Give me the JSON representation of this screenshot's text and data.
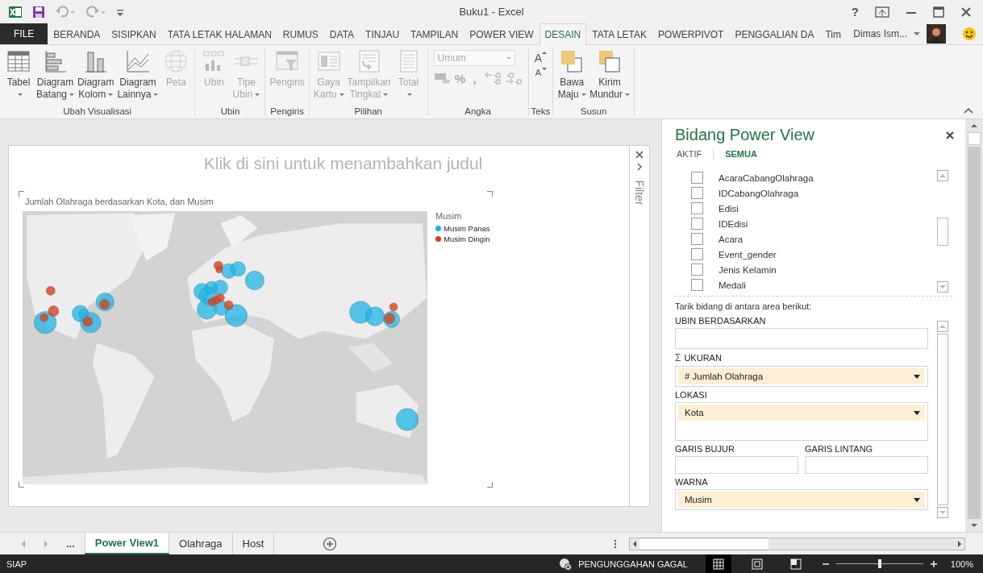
{
  "window": {
    "title": "Buku1 - Excel",
    "help": "?"
  },
  "ribbon_tabs": [
    {
      "label": "FILE",
      "kind": "file",
      "selected": false
    },
    {
      "label": "BERANDA",
      "kind": "tab",
      "selected": false
    },
    {
      "label": "SISIPKAN",
      "kind": "tab",
      "selected": false
    },
    {
      "label": "TATA LETAK HALAMAN",
      "kind": "tab",
      "selected": false
    },
    {
      "label": "RUMUS",
      "kind": "tab",
      "selected": false
    },
    {
      "label": "DATA",
      "kind": "tab",
      "selected": false
    },
    {
      "label": "TINJAU",
      "kind": "tab",
      "selected": false
    },
    {
      "label": "TAMPILAN",
      "kind": "tab",
      "selected": false
    },
    {
      "label": "POWER VIEW",
      "kind": "tab",
      "selected": false
    },
    {
      "label": "DESAIN",
      "kind": "tab",
      "selected": true
    },
    {
      "label": "TATA LETAK",
      "kind": "tab",
      "selected": false
    },
    {
      "label": "POWERPIVOT",
      "kind": "tab",
      "selected": false
    },
    {
      "label": "PENGGALIAN DA",
      "kind": "tab",
      "selected": false
    },
    {
      "label": "Tim",
      "kind": "tab",
      "selected": false
    }
  ],
  "account": {
    "name": "Dimas Ism..."
  },
  "ribbon_groups": [
    {
      "label": "Ubah Visualisasi",
      "kind": "commands",
      "commands": [
        {
          "lines": [
            "Tabel"
          ],
          "dropdown": true,
          "disabled": false
        },
        {
          "lines": [
            "Diagram",
            "Batang"
          ],
          "dropdown": true,
          "disabled": false
        },
        {
          "lines": [
            "Diagram",
            "Kolom"
          ],
          "dropdown": true,
          "disabled": false
        },
        {
          "lines": [
            "Diagram",
            "Lainnya"
          ],
          "dropdown": true,
          "disabled": false
        },
        {
          "lines": [
            "Peta"
          ],
          "dropdown": false,
          "disabled": true
        }
      ]
    },
    {
      "label": "Ubin",
      "kind": "commands",
      "commands": [
        {
          "lines": [
            "Ubin"
          ],
          "dropdown": false,
          "disabled": true
        },
        {
          "lines": [
            "Tipe",
            "Ubin"
          ],
          "dropdown": true,
          "disabled": true
        }
      ]
    },
    {
      "label": "Pengiris",
      "kind": "commands",
      "commands": [
        {
          "lines": [
            "Pengiris"
          ],
          "dropdown": false,
          "disabled": true
        }
      ]
    },
    {
      "label": "Pilihan",
      "kind": "commands",
      "commands": [
        {
          "lines": [
            "Gaya",
            "Kartu"
          ],
          "dropdown": true,
          "disabled": true
        },
        {
          "lines": [
            "Tampilkan",
            "Tingkat"
          ],
          "dropdown": true,
          "disabled": true
        },
        {
          "lines": [
            "Total"
          ],
          "dropdown": true,
          "disabled": true
        }
      ]
    },
    {
      "label": "Angka",
      "kind": "number",
      "format": "Umum",
      "symbols": [
        "%",
        ","
      ],
      "disabled": true
    },
    {
      "label": "Teks",
      "kind": "text",
      "buttons": [
        "A",
        "A"
      ]
    },
    {
      "label": "Susun",
      "kind": "commands",
      "commands": [
        {
          "lines": [
            "Bawa",
            "Maju"
          ],
          "dropdown": true,
          "disabled": false
        },
        {
          "lines": [
            "Kirim",
            "Mundur"
          ],
          "dropdown": true,
          "disabled": false
        }
      ]
    }
  ],
  "view": {
    "title_placeholder": "Klik di sini untuk menambahkan judul",
    "visualization": {
      "title": "Jumlah Olahraga berdasarkan Kota, dan Musim",
      "legend": {
        "title": "Musim",
        "items": [
          {
            "label": "Musim Panas",
            "color": "#1fb4e6"
          },
          {
            "label": "Musim Dingin",
            "color": "#d8421e"
          }
        ]
      }
    },
    "filter_pane": {
      "label": "Filter",
      "expanded": false
    }
  },
  "fields_panel": {
    "title": "Bidang Power View",
    "tabs": [
      {
        "label": "AKTIF",
        "selected": false
      },
      {
        "label": "SEMUA",
        "selected": true
      }
    ],
    "fields": [
      {
        "label": "AcaraCabangOlahraga",
        "checked": false
      },
      {
        "label": "IDCabangOlahraga",
        "checked": false
      },
      {
        "label": "Edisi",
        "checked": false
      },
      {
        "label": "IDEdisi",
        "checked": false
      },
      {
        "label": "Acara",
        "checked": false
      },
      {
        "label": "Event_gender",
        "checked": false
      },
      {
        "label": "Jenis Kelamin",
        "checked": false
      },
      {
        "label": "Medali",
        "checked": false
      }
    ],
    "hint": "Tarik bidang di antara area berikut:",
    "areas": [
      {
        "label": "UBIN BERDASARKAN",
        "kind": "single"
      },
      {
        "label": "UKURAN",
        "kind": "single",
        "prefix": "Σ",
        "value": "# Jumlah Olahraga"
      },
      {
        "label": "LOKASI",
        "kind": "multi",
        "value": "Kota"
      },
      {
        "label": "GARIS BUJUR",
        "kind": "half"
      },
      {
        "label": "GARIS LINTANG",
        "kind": "half"
      },
      {
        "label": "WARNA",
        "kind": "single",
        "value": "Musim"
      }
    ]
  },
  "sheet_nav": {
    "more": "..."
  },
  "sheet_tabs": [
    {
      "label": "Power View1",
      "selected": true
    },
    {
      "label": "Olahraga",
      "selected": false
    },
    {
      "label": "Host",
      "selected": false
    }
  ],
  "status_bar": {
    "status": "SIAP",
    "upload": "PENGUNGGAHAN GAGAL",
    "view_modes": [
      {
        "selected": true
      },
      {
        "selected": false
      },
      {
        "selected": false
      }
    ],
    "zoom": {
      "level": 0.5,
      "reading": "100%"
    }
  }
}
